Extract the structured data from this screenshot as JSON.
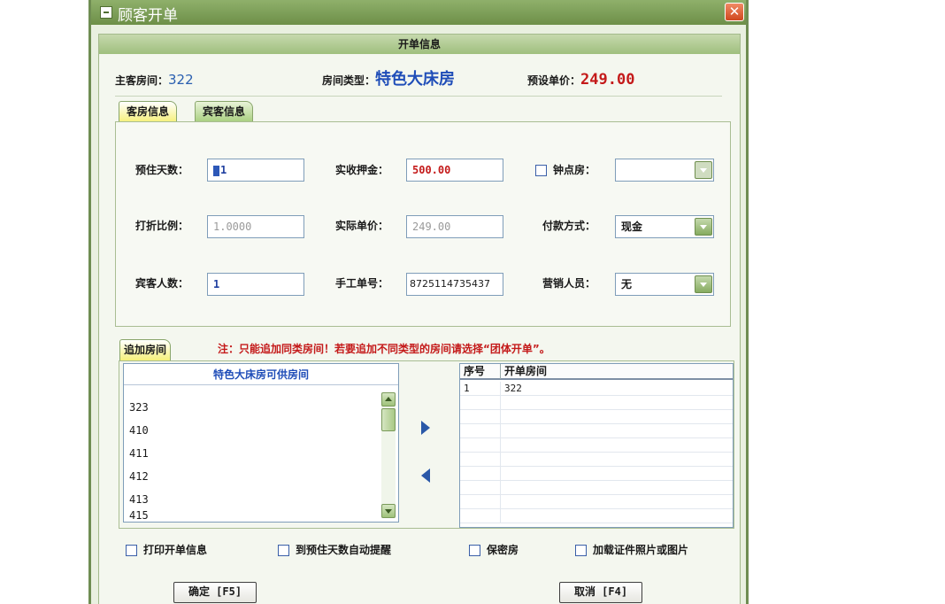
{
  "window": {
    "title": "顾客开单"
  },
  "section": {
    "title": "开单信息"
  },
  "summary": {
    "main_room_label": "主客房间：",
    "main_room_value": "322",
    "room_type_label": "房间类型：",
    "room_type_value": "特色大床房",
    "price_label": "预设单价：",
    "price_value": "249.00"
  },
  "tabs": [
    {
      "label": "客房信息",
      "active": true
    },
    {
      "label": "宾客信息",
      "active": false
    }
  ],
  "fields": {
    "stay_days": {
      "label": "预住天数：",
      "value": "1"
    },
    "deposit": {
      "label": "实收押金：",
      "value": "500.00"
    },
    "hourly": {
      "label": "钟点房：",
      "value": "",
      "checked": false
    },
    "discount": {
      "label": "打折比例：",
      "value": "1.0000"
    },
    "actual_price": {
      "label": "实际单价：",
      "value": "249.00"
    },
    "payment": {
      "label": "付款方式：",
      "value": "现金"
    },
    "guest_count": {
      "label": "宾客人数：",
      "value": "1"
    },
    "manual_no": {
      "label": "手工单号：",
      "value": "8725114735437"
    },
    "sales": {
      "label": "营销人员：",
      "value": "无"
    }
  },
  "add_rooms": {
    "tab_label": "追加房间",
    "note": "注：只能追加同类房间！若要追加不同类型的房间请选择“团体开单”。",
    "available_header": "特色大床房可供房间",
    "available_rooms": [
      "323",
      "410",
      "411",
      "412",
      "413",
      "415"
    ],
    "grid_headers": [
      "序号",
      "开单房间"
    ],
    "grid_rows": [
      {
        "seq": "1",
        "room": "322"
      }
    ]
  },
  "options": [
    {
      "label": "打印开单信息",
      "checked": false
    },
    {
      "label": "到预住天数自动提醒",
      "checked": false
    },
    {
      "label": "保密房",
      "checked": false
    },
    {
      "label": "加载证件照片或图片",
      "checked": false
    }
  ],
  "buttons": {
    "ok": "确定 [F5]",
    "cancel": "取消 [F4]"
  },
  "colors": {
    "title_bar": "#6d8f48",
    "accent_red": "#c41a1a",
    "accent_blue": "#1f4db8"
  }
}
